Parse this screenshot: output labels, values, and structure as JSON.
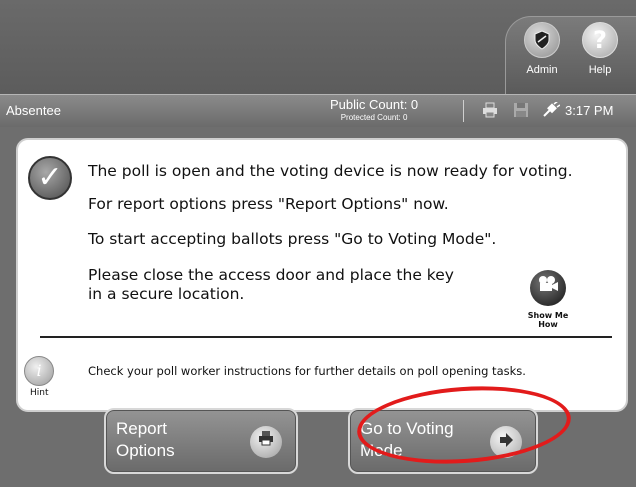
{
  "header": {
    "admin_label": "Admin",
    "help_label": "Help",
    "help_glyph": "?"
  },
  "status": {
    "mode": "Absentee",
    "public_count": "Public Count: 0",
    "protected_count": "Protected Count: 0",
    "time": "3:17 PM",
    "icons": [
      "printer-icon",
      "disk-icon",
      "power-plug-icon"
    ]
  },
  "panel": {
    "line1": "The poll is open and the voting device is now ready for voting.",
    "line2": "For report options press \"Report Options\" now.",
    "line3": "To start accepting ballots press \"Go to Voting Mode\".",
    "line4a": "Please close the access door and place the key",
    "line4b": "in a secure location.",
    "show_me_label": "Show Me How",
    "hint_label": "Hint",
    "hint_text": "Check your poll worker instructions for further details on poll opening tasks."
  },
  "buttons": {
    "report_line1": "Report",
    "report_line2": "Options",
    "voting_line1": "Go to Voting",
    "voting_line2": "Mode"
  },
  "colors": {
    "annotation_oval": "#e21b1b",
    "background": "#6e6e6e"
  }
}
